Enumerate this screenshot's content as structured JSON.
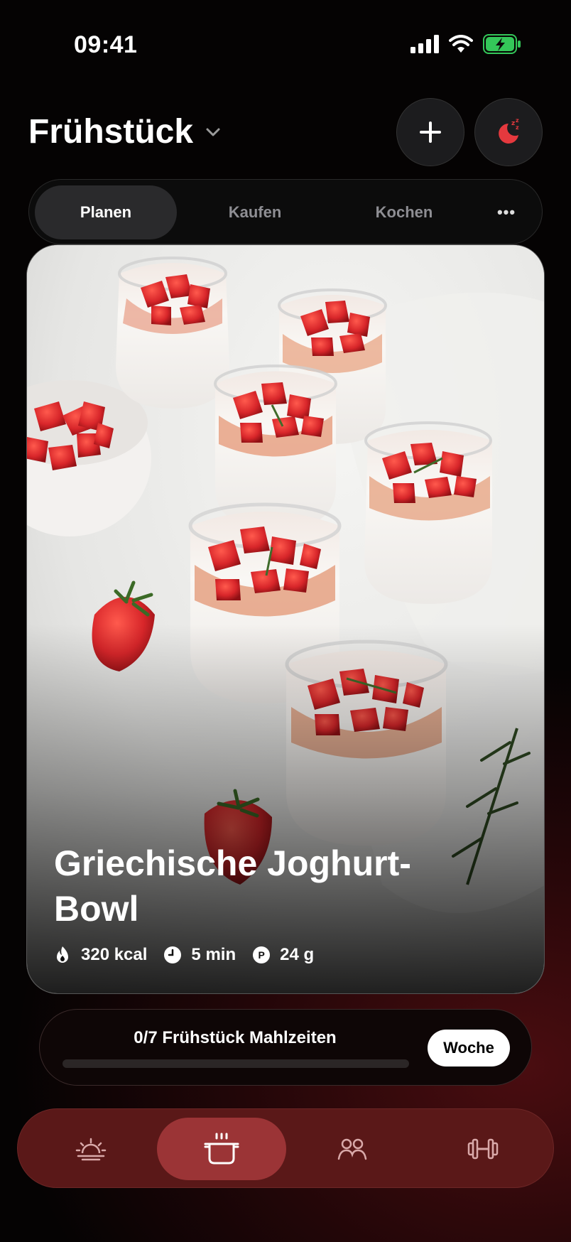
{
  "status_bar": {
    "time": "09:41"
  },
  "header": {
    "title": "Frühstück"
  },
  "tabs": [
    {
      "label": "Planen",
      "active": true
    },
    {
      "label": "Kaufen",
      "active": false
    },
    {
      "label": "Kochen",
      "active": false
    },
    {
      "label": "•••",
      "active": false
    }
  ],
  "recipe": {
    "title": "Griechische Joghurt-Bowl",
    "calories": "320 kcal",
    "time": "5 min",
    "protein": "24 g",
    "protein_icon_letter": "P"
  },
  "progress": {
    "label": "0/7 Frühstück Mahlzeiten",
    "fraction": 0,
    "button": "Woche"
  },
  "bottom_nav": [
    {
      "icon": "sunrise-icon",
      "active": false
    },
    {
      "icon": "cooking-pot-icon",
      "active": true
    },
    {
      "icon": "people-icon",
      "active": false
    },
    {
      "icon": "dumbbell-icon",
      "active": false
    }
  ],
  "colors": {
    "accent": "#9b3436",
    "nav_bg": "#5a1818",
    "battery": "#34c759",
    "sleep_icon": "#e5393e"
  }
}
